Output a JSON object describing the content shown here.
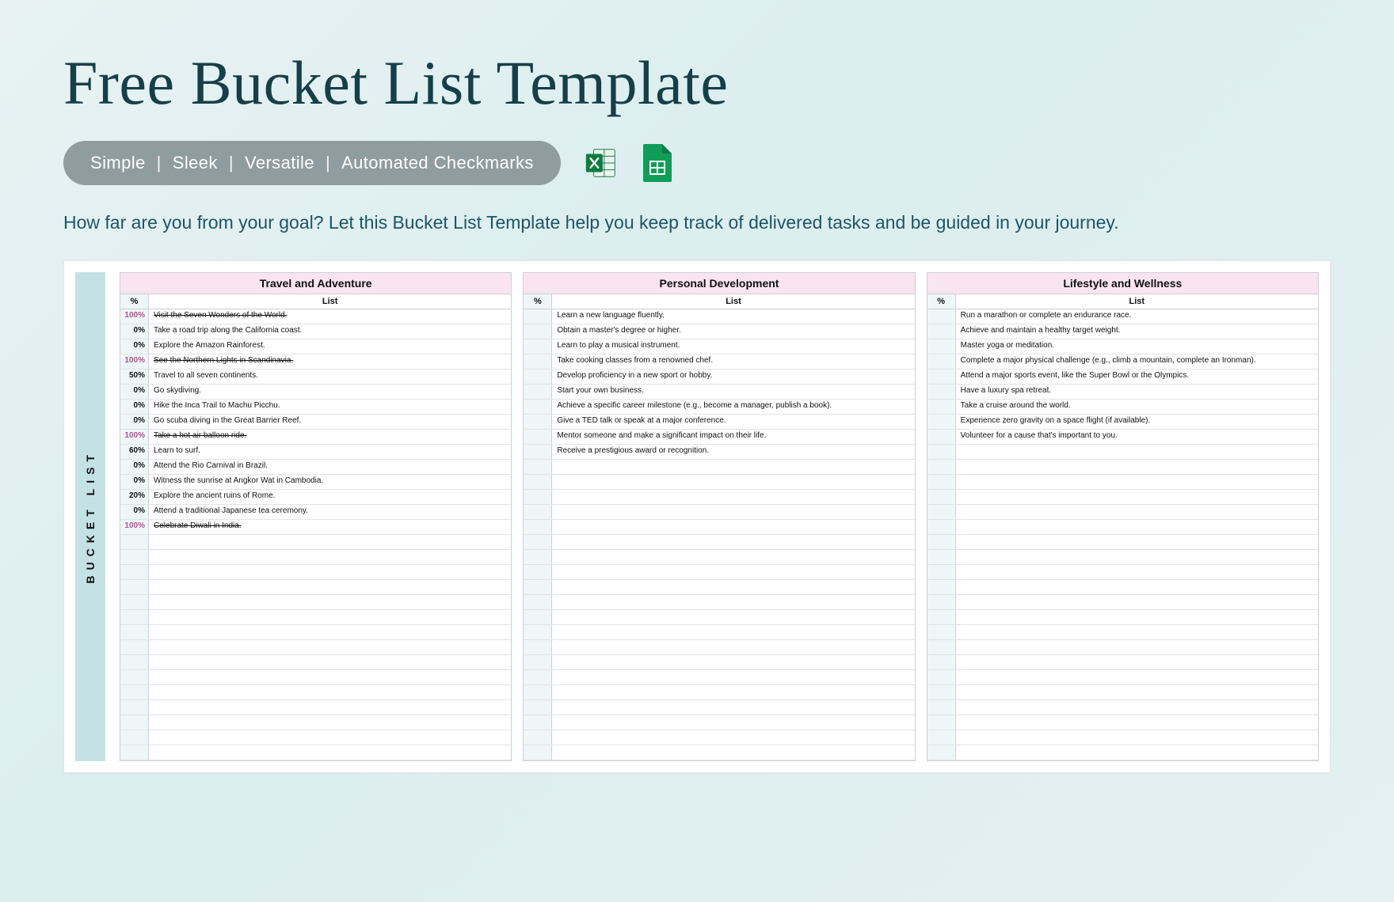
{
  "title": "Free Bucket List Template",
  "features": {
    "f1": "Simple",
    "f2": "Sleek",
    "f3": "Versatile",
    "f4": "Automated Checkmarks"
  },
  "description": "How far are you from your goal? Let this Bucket List Template help you keep track of delivered tasks and be guided in your journey.",
  "sidebar_label": "BUCKET LIST",
  "col_percent_label": "%",
  "col_list_label": "List",
  "empty_rows_per_category": 30,
  "categories": [
    {
      "name": "Travel and Adventure",
      "items": [
        {
          "percent": "100%",
          "text": "Visit the Seven Wonders of the World.",
          "done": true
        },
        {
          "percent": "0%",
          "text": "Take a road trip along the California coast.",
          "done": false
        },
        {
          "percent": "0%",
          "text": "Explore the Amazon Rainforest.",
          "done": false
        },
        {
          "percent": "100%",
          "text": "See the Northern Lights in Scandinavia.",
          "done": true
        },
        {
          "percent": "50%",
          "text": "Travel to all seven continents.",
          "done": false
        },
        {
          "percent": "0%",
          "text": "Go skydiving.",
          "done": false
        },
        {
          "percent": "0%",
          "text": "Hike the Inca Trail to Machu Picchu.",
          "done": false
        },
        {
          "percent": "0%",
          "text": "Go scuba diving in the Great Barrier Reef.",
          "done": false
        },
        {
          "percent": "100%",
          "text": "Take a hot air balloon ride.",
          "done": true
        },
        {
          "percent": "60%",
          "text": "Learn to surf.",
          "done": false
        },
        {
          "percent": "0%",
          "text": "Attend the Rio Carnival in Brazil.",
          "done": false
        },
        {
          "percent": "0%",
          "text": "Witness the sunrise at Angkor Wat in Cambodia.",
          "done": false
        },
        {
          "percent": "20%",
          "text": "Explore the ancient ruins of Rome.",
          "done": false
        },
        {
          "percent": "0%",
          "text": "Attend a traditional Japanese tea ceremony.",
          "done": false
        },
        {
          "percent": "100%",
          "text": "Celebrate Diwali in India.",
          "done": true
        }
      ]
    },
    {
      "name": "Personal Development",
      "items": [
        {
          "percent": "",
          "text": "Learn a new language fluently.",
          "done": false
        },
        {
          "percent": "",
          "text": "Obtain a master's degree or higher.",
          "done": false
        },
        {
          "percent": "",
          "text": "Learn to play a musical instrument.",
          "done": false
        },
        {
          "percent": "",
          "text": "Take cooking classes from a renowned chef.",
          "done": false
        },
        {
          "percent": "",
          "text": "Develop proficiency in a new sport or hobby.",
          "done": false
        },
        {
          "percent": "",
          "text": "Start your own business.",
          "done": false
        },
        {
          "percent": "",
          "text": "Achieve a specific career milestone (e.g., become a manager, publish a book).",
          "done": false
        },
        {
          "percent": "",
          "text": "Give a TED talk or speak at a major conference.",
          "done": false
        },
        {
          "percent": "",
          "text": "Mentor someone and make a significant impact on their life.",
          "done": false
        },
        {
          "percent": "",
          "text": "Receive a prestigious award or recognition.",
          "done": false
        }
      ]
    },
    {
      "name": "Lifestyle and Wellness",
      "items": [
        {
          "percent": "",
          "text": "Run a marathon or complete an endurance race.",
          "done": false
        },
        {
          "percent": "",
          "text": "Achieve and maintain a healthy target weight.",
          "done": false
        },
        {
          "percent": "",
          "text": "Master yoga or meditation.",
          "done": false
        },
        {
          "percent": "",
          "text": "Complete a major physical challenge (e.g., climb a mountain, complete an Ironman).",
          "done": false
        },
        {
          "percent": "",
          "text": "Attend a major sports event, like the Super Bowl or the Olympics.",
          "done": false
        },
        {
          "percent": "",
          "text": "Have a luxury spa retreat.",
          "done": false
        },
        {
          "percent": "",
          "text": "Take a cruise around the world.",
          "done": false
        },
        {
          "percent": "",
          "text": "Experience zero gravity on a space flight (if available).",
          "done": false
        },
        {
          "percent": "",
          "text": "Volunteer for a cause that's important to you.",
          "done": false
        }
      ]
    }
  ]
}
